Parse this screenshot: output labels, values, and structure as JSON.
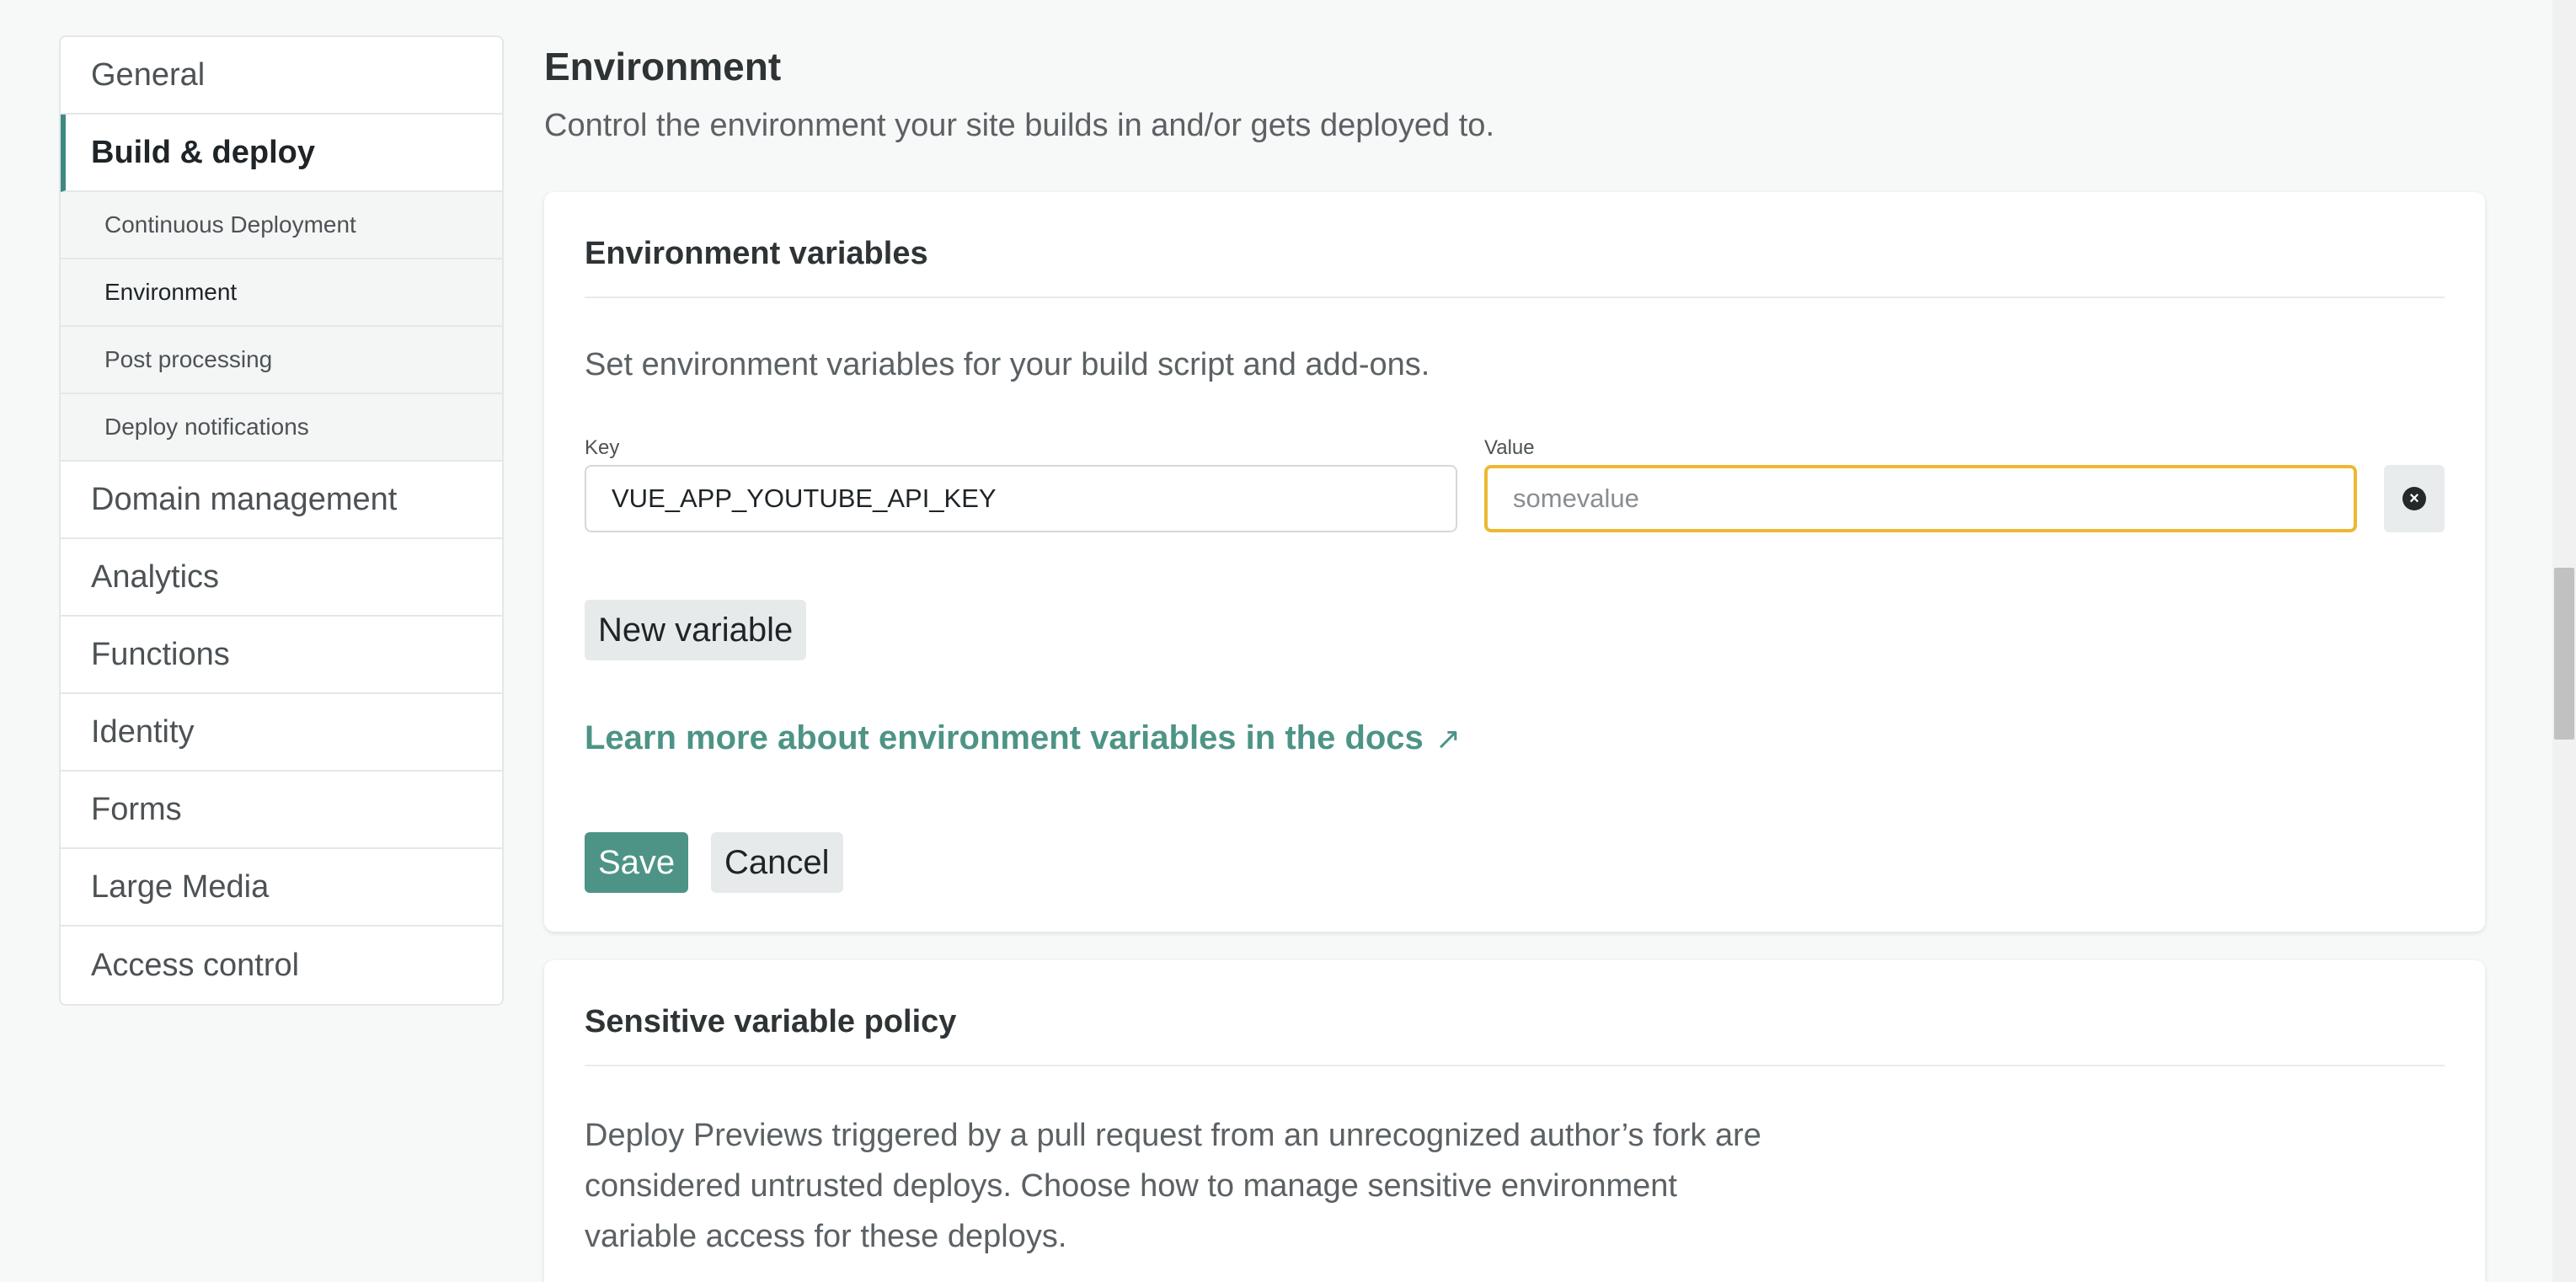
{
  "sidebar": {
    "items": [
      {
        "label": "General"
      },
      {
        "label": "Build & deploy",
        "sub_items": [
          {
            "label": "Continuous Deployment"
          },
          {
            "label": "Environment"
          },
          {
            "label": "Post processing"
          },
          {
            "label": "Deploy notifications"
          }
        ]
      },
      {
        "label": "Domain management"
      },
      {
        "label": "Analytics"
      },
      {
        "label": "Functions"
      },
      {
        "label": "Identity"
      },
      {
        "label": "Forms"
      },
      {
        "label": "Large Media"
      },
      {
        "label": "Access control"
      }
    ]
  },
  "main": {
    "title": "Environment",
    "description": "Control the environment your site builds in and/or gets deployed to.",
    "env_card": {
      "title": "Environment variables",
      "description": "Set environment variables for your build script and add-ons.",
      "key_label": "Key",
      "value_label": "Value",
      "key_value": "VUE_APP_YOUTUBE_API_KEY",
      "value_placeholder": "somevalue",
      "new_variable_label": "New variable",
      "docs_link_label": "Learn more about environment variables in the docs",
      "docs_link_arrow": "↗",
      "save_label": "Save",
      "cancel_label": "Cancel"
    },
    "policy_card": {
      "title": "Sensitive variable policy",
      "description": "Deploy Previews triggered by a pull request from an unrecognized author’s fork are considered untrusted deploys. Choose how to manage sensitive environment variable access for these deploys."
    }
  },
  "colors": {
    "accent": "#4d9486",
    "focus_border": "#edb831"
  }
}
